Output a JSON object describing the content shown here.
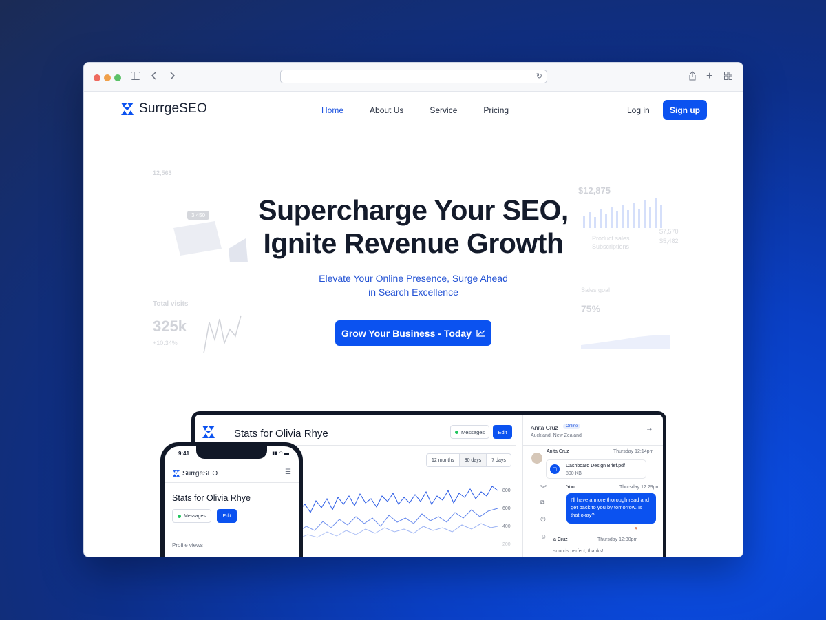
{
  "browser": {
    "address_text": "",
    "icons": {
      "sidebar": "sidebar-icon",
      "back": "chevron-left-icon",
      "forward": "chevron-right-icon",
      "reload": "reload-icon",
      "share": "share-icon",
      "new_tab": "plus-icon",
      "tabs": "grid-icon"
    }
  },
  "nav": {
    "brand": "SurrgeSEO",
    "links": [
      "Home",
      "About Us",
      "Service",
      "Pricing"
    ],
    "active": "Home",
    "login": "Log in",
    "signup": "Sign up"
  },
  "hero": {
    "title_line1": "Supercharge Your SEO,",
    "title_line2": "Ignite Revenue Growth",
    "subtitle_line1": "Elevate Your Online Presence, Surge Ahead",
    "subtitle_line2": "in Search Excellence",
    "cta": "Grow Your Business - Today",
    "cta_icon": "line-chart-icon"
  },
  "ghost_cards": {
    "left_top": {
      "value": "12,563",
      "chip": "3,450"
    },
    "left_bottom": {
      "label": "Total visits",
      "value": "325k",
      "delta": "+10.34%"
    },
    "right_top": {
      "value": "$12,875",
      "legend1": "Product sales",
      "legend2": "Subscriptions",
      "v1": "$7,570",
      "v2": "$5,482"
    },
    "right_bottom": {
      "label": "Sales goal",
      "value": "75%"
    }
  },
  "dashboard": {
    "title": "Stats for Olivia Rhye",
    "messages": "Messages",
    "edit": "Edit",
    "ranges": [
      "12 months",
      "30 days",
      "7 days"
    ],
    "active_range": "30 days",
    "chat": {
      "name": "Anita Cruz",
      "status": "Online",
      "location": "Auckland, New Zealand",
      "msg1_sender": "Anita Cruz",
      "msg1_time": "Thursday 12:14pm",
      "file_name": "Dashboard Design Brief.pdf",
      "file_size": "800 KB",
      "msg2_sender": "You",
      "msg2_time": "Thursday 12:29pm",
      "msg2_text": "I'll have a more thorough read and get back to you by tomorrow. Is that okay?",
      "msg3_sender": "a Cruz",
      "msg3_time": "Thursday 12:30pm",
      "msg3_text": "sounds perfect, thanks!"
    }
  },
  "phone": {
    "time": "9:41",
    "brand": "SurrgeSEO",
    "title": "Stats for Olivia Rhye",
    "messages": "Messages",
    "edit": "Edit",
    "section": "Profile views"
  }
}
